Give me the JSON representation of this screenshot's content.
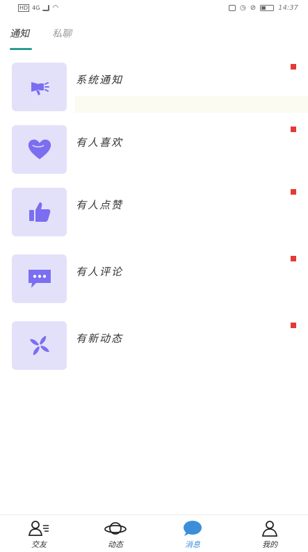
{
  "status_bar": {
    "left_indicators": [
      "HD",
      "4G"
    ],
    "time": "14:37"
  },
  "tabs": [
    {
      "label": "通知",
      "active": true
    },
    {
      "label": "私聊",
      "active": false
    }
  ],
  "notifications": [
    {
      "label": "系统通知",
      "icon": "megaphone-icon",
      "unread": true
    },
    {
      "label": "有人喜欢",
      "icon": "heart-icon",
      "unread": true
    },
    {
      "label": "有人点赞",
      "icon": "thumbs-up-icon",
      "unread": true
    },
    {
      "label": "有人评论",
      "icon": "comment-icon",
      "unread": true
    },
    {
      "label": "有新动态",
      "icon": "pinwheel-icon",
      "unread": true
    }
  ],
  "bottom_nav": [
    {
      "label": "交友",
      "icon": "people-icon",
      "active": false
    },
    {
      "label": "动态",
      "icon": "planet-icon",
      "active": false
    },
    {
      "label": "消息",
      "icon": "chat-bubble-icon",
      "active": true
    },
    {
      "label": "我的",
      "icon": "person-icon",
      "active": false
    }
  ],
  "colors": {
    "accent": "#2a9d8f",
    "icon_bg": "#e3e1fa",
    "icon_fg": "#7b6ef0",
    "unread_dot": "#e53935",
    "nav_active": "#3b8fd9"
  }
}
